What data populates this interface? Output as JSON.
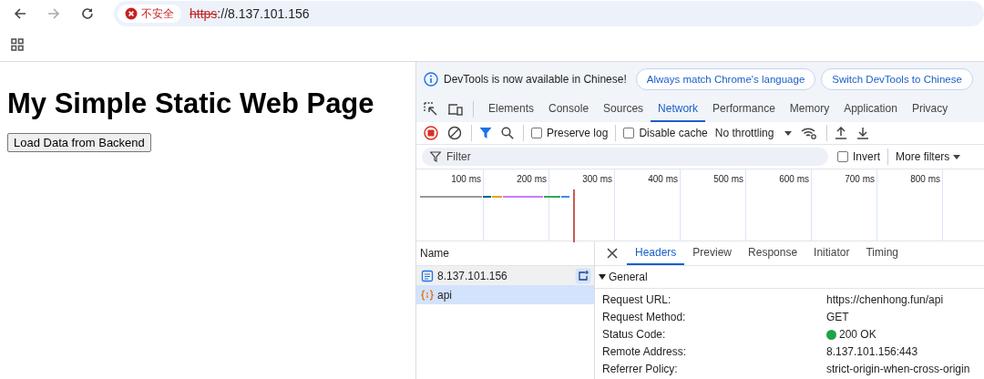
{
  "browser": {
    "security_label": "不安全",
    "url_scheme": "https",
    "url_rest": "://8.137.101.156"
  },
  "page": {
    "heading": "My Simple Static Web Page",
    "button": "Load Data from Backend"
  },
  "devtools": {
    "infobar": {
      "message": "DevTools is now available in Chinese!",
      "buttons": [
        "Always match Chrome's language",
        "Switch DevTools to Chinese"
      ]
    },
    "tabs": [
      {
        "label": "Elements",
        "selected": false
      },
      {
        "label": "Console",
        "selected": false
      },
      {
        "label": "Sources",
        "selected": false
      },
      {
        "label": "Network",
        "selected": true
      },
      {
        "label": "Performance",
        "selected": false
      },
      {
        "label": "Memory",
        "selected": false
      },
      {
        "label": "Application",
        "selected": false
      },
      {
        "label": "Privacy",
        "selected": false
      }
    ],
    "toolbar": {
      "checkboxes": [
        {
          "label": "Preserve log",
          "checked": false
        },
        {
          "label": "Disable cache",
          "checked": false
        }
      ],
      "throttling": "No throttling"
    },
    "filter": {
      "placeholder": "Filter",
      "invert": {
        "label": "Invert",
        "checked": false
      },
      "more_filters": "More filters"
    },
    "timeline_ticks": [
      "100 ms",
      "200 ms",
      "300 ms",
      "400 ms",
      "500 ms",
      "600 ms",
      "700 ms",
      "800 ms"
    ],
    "requests": {
      "column": "Name",
      "rows": [
        {
          "name": "8.137.101.156",
          "kind": "document",
          "selected": false,
          "hovered": true
        },
        {
          "name": "api",
          "kind": "script",
          "selected": true,
          "hovered": false
        }
      ]
    },
    "detail_tabs": [
      {
        "label": "Headers",
        "selected": true
      },
      {
        "label": "Preview",
        "selected": false
      },
      {
        "label": "Response",
        "selected": false
      },
      {
        "label": "Initiator",
        "selected": false
      },
      {
        "label": "Timing",
        "selected": false
      }
    ],
    "general": {
      "title": "General",
      "expanded": true,
      "rows": [
        {
          "key": "Request URL:",
          "value": "https://chenhong.fun/api",
          "kind": "text"
        },
        {
          "key": "Request Method:",
          "value": "GET",
          "kind": "text"
        },
        {
          "key": "Status Code:",
          "value": "200 OK",
          "kind": "status"
        },
        {
          "key": "Remote Address:",
          "value": "8.137.101.156:443",
          "kind": "text"
        },
        {
          "key": "Referrer Policy:",
          "value": "strict-origin-when-cross-origin",
          "kind": "text"
        }
      ]
    }
  }
}
